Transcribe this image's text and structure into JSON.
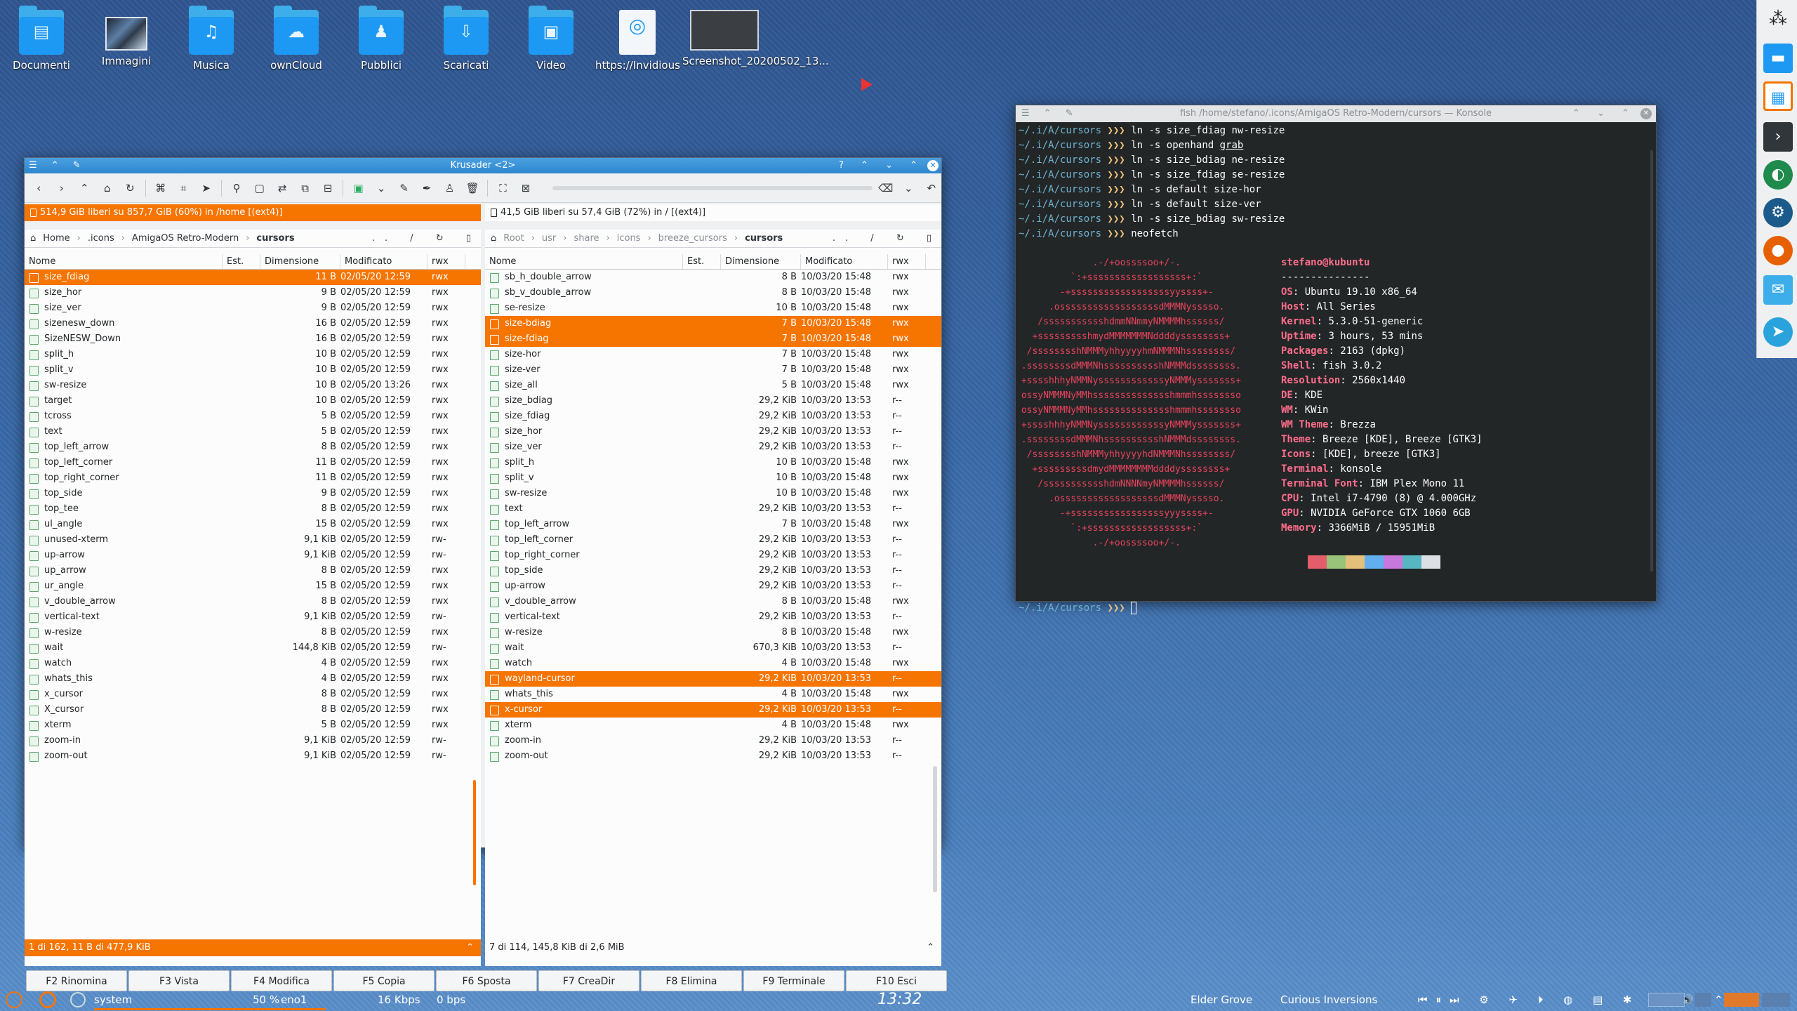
{
  "desktop": {
    "icons": [
      {
        "label": "Documenti",
        "glyph": "▤",
        "kind": "folder"
      },
      {
        "label": "Immagini",
        "glyph": "",
        "kind": "photo"
      },
      {
        "label": "Musica",
        "glyph": "♫",
        "kind": "folder"
      },
      {
        "label": "ownCloud",
        "glyph": "☁",
        "kind": "folder"
      },
      {
        "label": "Pubblici",
        "glyph": "♟",
        "kind": "folder"
      },
      {
        "label": "Scaricati",
        "glyph": "⇩",
        "kind": "folder"
      },
      {
        "label": "Video",
        "glyph": "▣",
        "kind": "folder"
      },
      {
        "label": "https://Invidious",
        "glyph": "◎",
        "kind": "file"
      },
      {
        "label": "Screenshot_20200502_13...",
        "glyph": "",
        "kind": "shot"
      }
    ]
  },
  "krusader": {
    "title": "Krusader <2>",
    "left": {
      "free": "514,9 GiB liberi su 857,7 GiB (60%) in /home [(ext4)]",
      "crumbs": [
        "Home",
        ".icons",
        "AmigaOS Retro-Modern",
        "cursors"
      ],
      "headers": {
        "name": "Nome",
        "ext": "Est.",
        "size": "Dimensione",
        "mod": "Modificato",
        "perm": "rwx"
      },
      "rows": [
        [
          "size_fdiag",
          "11 B",
          "02/05/20 12:59",
          "rwx",
          1
        ],
        [
          "size_hor",
          "9 B",
          "02/05/20 12:59",
          "rwx",
          0
        ],
        [
          "size_ver",
          "9 B",
          "02/05/20 12:59",
          "rwx",
          0
        ],
        [
          "sizenesw_down",
          "16 B",
          "02/05/20 12:59",
          "rwx",
          0
        ],
        [
          "SizeNESW_Down",
          "16 B",
          "02/05/20 12:59",
          "rwx",
          0
        ],
        [
          "split_h",
          "10 B",
          "02/05/20 12:59",
          "rwx",
          0
        ],
        [
          "split_v",
          "10 B",
          "02/05/20 12:59",
          "rwx",
          0
        ],
        [
          "sw-resize",
          "10 B",
          "02/05/20 13:26",
          "rwx",
          0
        ],
        [
          "target",
          "10 B",
          "02/05/20 12:59",
          "rwx",
          0
        ],
        [
          "tcross",
          "5 B",
          "02/05/20 12:59",
          "rwx",
          0
        ],
        [
          "text",
          "5 B",
          "02/05/20 12:59",
          "rwx",
          0
        ],
        [
          "top_left_arrow",
          "8 B",
          "02/05/20 12:59",
          "rwx",
          0
        ],
        [
          "top_left_corner",
          "11 B",
          "02/05/20 12:59",
          "rwx",
          0
        ],
        [
          "top_right_corner",
          "11 B",
          "02/05/20 12:59",
          "rwx",
          0
        ],
        [
          "top_side",
          "9 B",
          "02/05/20 12:59",
          "rwx",
          0
        ],
        [
          "top_tee",
          "8 B",
          "02/05/20 12:59",
          "rwx",
          0
        ],
        [
          "ul_angle",
          "15 B",
          "02/05/20 12:59",
          "rwx",
          0
        ],
        [
          "unused-xterm",
          "9,1 KiB",
          "02/05/20 12:59",
          "rw-",
          0
        ],
        [
          "up-arrow",
          "9,1 KiB",
          "02/05/20 12:59",
          "rw-",
          0
        ],
        [
          "up_arrow",
          "8 B",
          "02/05/20 12:59",
          "rwx",
          0
        ],
        [
          "ur_angle",
          "15 B",
          "02/05/20 12:59",
          "rwx",
          0
        ],
        [
          "v_double_arrow",
          "8 B",
          "02/05/20 12:59",
          "rwx",
          0
        ],
        [
          "vertical-text",
          "9,1 KiB",
          "02/05/20 12:59",
          "rw-",
          0
        ],
        [
          "w-resize",
          "8 B",
          "02/05/20 12:59",
          "rwx",
          0
        ],
        [
          "wait",
          "144,8 KiB",
          "02/05/20 12:59",
          "rw-",
          0
        ],
        [
          "watch",
          "4 B",
          "02/05/20 12:59",
          "rwx",
          0
        ],
        [
          "whats_this",
          "4 B",
          "02/05/20 12:59",
          "rwx",
          0
        ],
        [
          "x_cursor",
          "8 B",
          "02/05/20 12:59",
          "rwx",
          0
        ],
        [
          "X_cursor",
          "8 B",
          "02/05/20 12:59",
          "rwx",
          0
        ],
        [
          "xterm",
          "5 B",
          "02/05/20 12:59",
          "rwx",
          0
        ],
        [
          "zoom-in",
          "9,1 KiB",
          "02/05/20 12:59",
          "rw-",
          0
        ],
        [
          "zoom-out",
          "9,1 KiB",
          "02/05/20 12:59",
          "rw-",
          0
        ]
      ],
      "status": "1 di 162, 11 B di 477,9 KiB"
    },
    "right": {
      "free": "41,5 GiB liberi su 57,4 GiB (72%) in / [(ext4)]",
      "crumbs": [
        "Root",
        "usr",
        "share",
        "icons",
        "breeze_cursors",
        "cursors"
      ],
      "headers": {
        "name": "Nome",
        "ext": "Est.",
        "size": "Dimensione",
        "mod": "Modificato",
        "perm": "rwx"
      },
      "rows": [
        [
          "sb_h_double_arrow",
          "8 B",
          "10/03/20 15:48",
          "rwx",
          0
        ],
        [
          "sb_v_double_arrow",
          "8 B",
          "10/03/20 15:48",
          "rwx",
          0
        ],
        [
          "se-resize",
          "10 B",
          "10/03/20 15:48",
          "rwx",
          0
        ],
        [
          "size-bdiag",
          "7 B",
          "10/03/20 15:48",
          "rwx",
          1
        ],
        [
          "size-fdiag",
          "7 B",
          "10/03/20 15:48",
          "rwx",
          1
        ],
        [
          "size-hor",
          "7 B",
          "10/03/20 15:48",
          "rwx",
          0
        ],
        [
          "size-ver",
          "7 B",
          "10/03/20 15:48",
          "rwx",
          0
        ],
        [
          "size_all",
          "5 B",
          "10/03/20 15:48",
          "rwx",
          0
        ],
        [
          "size_bdiag",
          "29,2 KiB",
          "10/03/20 13:53",
          "r--",
          0
        ],
        [
          "size_fdiag",
          "29,2 KiB",
          "10/03/20 13:53",
          "r--",
          0
        ],
        [
          "size_hor",
          "29,2 KiB",
          "10/03/20 13:53",
          "r--",
          0
        ],
        [
          "size_ver",
          "29,2 KiB",
          "10/03/20 13:53",
          "r--",
          0
        ],
        [
          "split_h",
          "10 B",
          "10/03/20 15:48",
          "rwx",
          0
        ],
        [
          "split_v",
          "10 B",
          "10/03/20 15:48",
          "rwx",
          0
        ],
        [
          "sw-resize",
          "10 B",
          "10/03/20 15:48",
          "rwx",
          0
        ],
        [
          "text",
          "29,2 KiB",
          "10/03/20 13:53",
          "r--",
          0
        ],
        [
          "top_left_arrow",
          "7 B",
          "10/03/20 15:48",
          "rwx",
          0
        ],
        [
          "top_left_corner",
          "29,2 KiB",
          "10/03/20 13:53",
          "r--",
          0
        ],
        [
          "top_right_corner",
          "29,2 KiB",
          "10/03/20 13:53",
          "r--",
          0
        ],
        [
          "top_side",
          "29,2 KiB",
          "10/03/20 13:53",
          "r--",
          0
        ],
        [
          "up-arrow",
          "29,2 KiB",
          "10/03/20 13:53",
          "r--",
          0
        ],
        [
          "v_double_arrow",
          "8 B",
          "10/03/20 15:48",
          "rwx",
          0
        ],
        [
          "vertical-text",
          "29,2 KiB",
          "10/03/20 13:53",
          "r--",
          0
        ],
        [
          "w-resize",
          "8 B",
          "10/03/20 15:48",
          "rwx",
          0
        ],
        [
          "wait",
          "670,3 KiB",
          "10/03/20 13:53",
          "r--",
          0
        ],
        [
          "watch",
          "4 B",
          "10/03/20 15:48",
          "rwx",
          0
        ],
        [
          "wayland-cursor",
          "29,2 KiB",
          "10/03/20 13:53",
          "r--",
          1
        ],
        [
          "whats_this",
          "4 B",
          "10/03/20 15:48",
          "rwx",
          0
        ],
        [
          "x-cursor",
          "29,2 KiB",
          "10/03/20 13:53",
          "r--",
          1
        ],
        [
          "xterm",
          "4 B",
          "10/03/20 15:48",
          "rwx",
          0
        ],
        [
          "zoom-in",
          "29,2 KiB",
          "10/03/20 13:53",
          "r--",
          0
        ],
        [
          "zoom-out",
          "29,2 KiB",
          "10/03/20 13:53",
          "r--",
          0
        ]
      ],
      "status": "7 di 114, 145,8 KiB di 2,6 MiB"
    },
    "fkeys": [
      "F2 Rinomina",
      "F3 Vista",
      "F4 Modifica",
      "F5 Copia",
      "F6 Sposta",
      "F7 CreaDir",
      "F8 Elimina",
      "F9 Terminale",
      "F10 Esci"
    ]
  },
  "konsole": {
    "title": "fish /home/stefano/.icons/AmigaOS Retro-Modern/cursors — Konsole",
    "prompt": "~/.i/A/cursors",
    "arrows": "❯❯❯",
    "commands": [
      [
        "ln -s size_fdiag nw-resize",
        ""
      ],
      [
        "ln -s openhand ",
        "grab"
      ],
      [
        "ln -s size_bdiag ne-resize",
        ""
      ],
      [
        "ln -s size_fdiag se-resize",
        ""
      ],
      [
        "ln -s default size-hor",
        ""
      ],
      [
        "ln -s default size-ver",
        ""
      ],
      [
        "ln -s size_bdiag sw-resize",
        ""
      ],
      [
        "neofetch",
        ""
      ]
    ],
    "ascii": [
      "              .-/+oossssoo+/-.",
      "          `:+ssssssssssssssssss+:`",
      "        -+ssssssssssssssssssyyssss+-",
      "      .ossssssssssssssssssdMMMNysssso.",
      "    /ssssssssssshdmmNNmmyNMMMMhssssss/",
      "   +ssssssssshmydMMMMMMMNddddyssssssss+",
      "  /sssssssshNMMMyhhyyyyhmNMMMNhssssssss/",
      " .ssssssssdMMMNhsssssssssshNMMMdssssssss.",
      " +sssshhhyNMMNyssssssssssssyNMMMysssssss+",
      " ossyNMMMNyMMhsssssssssssssshmmmhssssssso",
      " ossyNMMMNyMMhsssssssssssssshmmmhssssssso",
      " +sssshhhyNMMNyssssssssssssyNMMMysssssss+",
      " .ssssssssdMMMNhsssssssssshNMMMdssssssss.",
      "  /sssssssshNMMMyhhyyyyhdNMMMNhssssssss/",
      "   +sssssssssdmydMMMMMMMMddddyssssssss+",
      "    /ssssssssssshdmNNNNmyNMMMMhssssss/",
      "      .ossssssssssssssssssdMMMNysssso.",
      "        -+sssssssssssssssssyyyssss+-",
      "          `:+ssssssssssssssssss+:`",
      "              .-/+oossssoo+/-."
    ],
    "userhost": "stefano@kubuntu",
    "dashes": "---------------",
    "info": [
      [
        "OS",
        "Ubuntu 19.10 x86_64"
      ],
      [
        "Host",
        "All Series"
      ],
      [
        "Kernel",
        "5.3.0-51-generic"
      ],
      [
        "Uptime",
        "3 hours, 53 mins"
      ],
      [
        "Packages",
        "2163 (dpkg)"
      ],
      [
        "Shell",
        "fish 3.0.2"
      ],
      [
        "Resolution",
        "2560x1440"
      ],
      [
        "DE",
        "KDE"
      ],
      [
        "WM",
        "KWin"
      ],
      [
        "WM Theme",
        "Brezza"
      ],
      [
        "Theme",
        "Breeze [KDE], Breeze [GTK3]"
      ],
      [
        "Icons",
        "[KDE], breeze [GTK3]"
      ],
      [
        "Terminal",
        "konsole"
      ],
      [
        "Terminal Font",
        "IBM Plex Mono 11"
      ],
      [
        "CPU",
        "Intel i7-4790 (8) @ 4.000GHz"
      ],
      [
        "GPU",
        "NVIDIA GeForce GTX 1060 6GB"
      ],
      [
        "Memory",
        "3366MiB / 15951MiB"
      ]
    ],
    "colors": [
      "#e35d6a",
      "#98c379",
      "#e5c07b",
      "#61afef",
      "#c678dd",
      "#56b6c2",
      "#dcdfe4"
    ]
  },
  "panel": {
    "system": "system",
    "cpu": "50 %",
    "net": "eno1",
    "down": "16 Kbps",
    "up": "0 bps",
    "clock": "13:32",
    "a1": "Elder Grove",
    "a2": "Curious Inversions"
  }
}
